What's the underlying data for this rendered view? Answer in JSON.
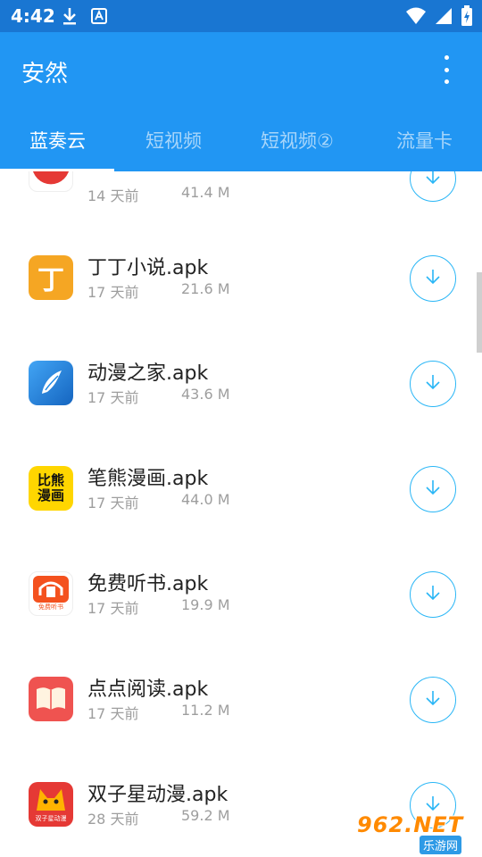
{
  "status_bar": {
    "time": "4:42",
    "icons": [
      "download-icon",
      "a-icon",
      "wifi-icon",
      "signal-icon",
      "battery-charging-icon"
    ]
  },
  "app_bar": {
    "title": "安然",
    "menu_icon": "more-vert-icon",
    "color": "#2196f3"
  },
  "tabs": [
    {
      "label": "蓝奏云",
      "active": true
    },
    {
      "label": "短视频",
      "active": false
    },
    {
      "label": "短视频②",
      "active": false
    },
    {
      "label": "流量卡",
      "active": false
    }
  ],
  "files": [
    {
      "name": "",
      "date": "14 天前",
      "size": "41.4 M",
      "icon": "partial-red-app-icon",
      "icon_color": "#e53935"
    },
    {
      "name": "丁丁小说.apk",
      "date": "17 天前",
      "size": "21.6 M",
      "icon": "dingding-novel-icon",
      "icon_color": "#f5a623",
      "icon_text": "丁"
    },
    {
      "name": "动漫之家.apk",
      "date": "17 天前",
      "size": "43.6 M",
      "icon": "dongman-zhijia-icon",
      "icon_color": "#1e88e5"
    },
    {
      "name": "笔熊漫画.apk",
      "date": "17 天前",
      "size": "44.0 M",
      "icon": "bixiong-comic-icon",
      "icon_color": "#ffd600",
      "icon_text": "比熊\n漫画"
    },
    {
      "name": "免费听书.apk",
      "date": "17 天前",
      "size": "19.9 M",
      "icon": "free-audiobook-icon",
      "icon_color": "#f4511e",
      "icon_text": "免费听书"
    },
    {
      "name": "点点阅读.apk",
      "date": "17 天前",
      "size": "11.2 M",
      "icon": "diandian-reading-icon",
      "icon_color": "#ef5350"
    },
    {
      "name": "双子星动漫.apk",
      "date": "28 天前",
      "size": "59.2 M",
      "icon": "shuangzixing-comic-icon",
      "icon_color": "#e53935",
      "icon_text": "双子星动漫"
    }
  ],
  "download_icon": "download-arrow-icon",
  "accent_color": "#29b6f6",
  "watermark": {
    "main": "962.NET",
    "sub": "乐游网"
  }
}
